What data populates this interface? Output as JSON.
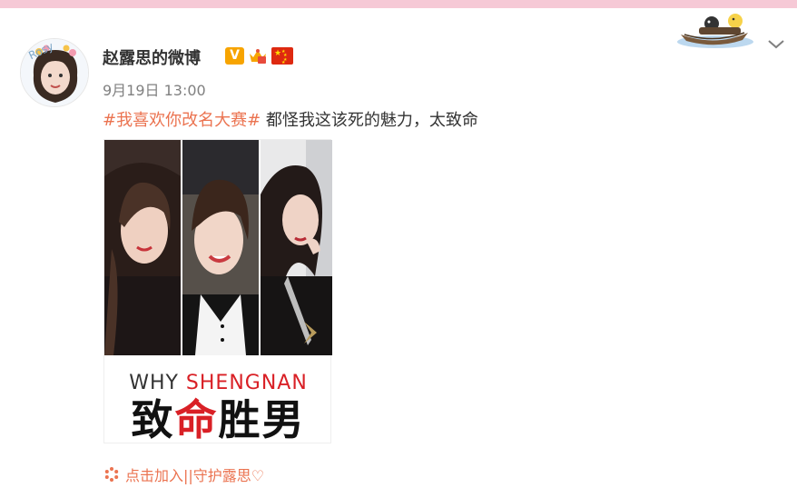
{
  "post": {
    "username": "赵露思的微博",
    "verified_mark": "V",
    "timestamp": "9月19日 13:00",
    "hashtag": "#我喜欢你改名大赛#",
    "text": " 都怪我这该死的魅力，太致命",
    "avatar_tag": "Rosy"
  },
  "media": {
    "why": "WHY ",
    "name": "SHENGNAN",
    "title_part1": "致",
    "title_accent": "命",
    "title_part2": "胜男"
  },
  "footer": {
    "link_label": "点击加入||守护露思♡"
  },
  "icons": {
    "more": "chevron-down-icon",
    "footer": "flower-icon",
    "decor": "boat-sticker-icon"
  },
  "colors": {
    "accent": "#eb7350",
    "top_strip": "#f6c9d6",
    "title_red": "#d92026",
    "verified": "#f7a400"
  }
}
